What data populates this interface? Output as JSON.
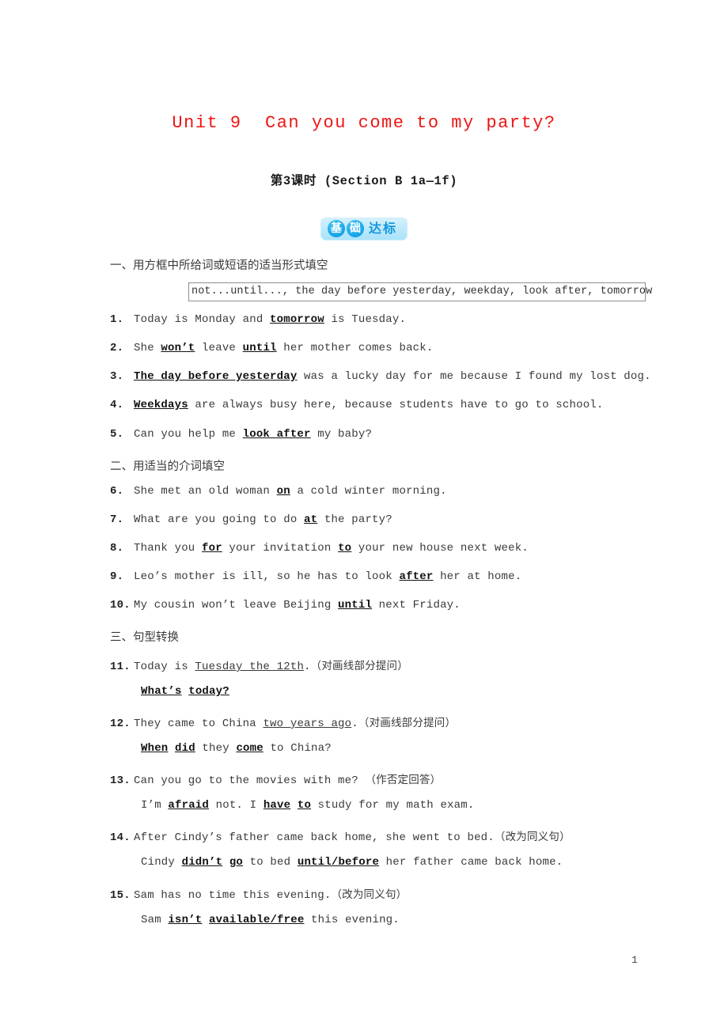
{
  "document": {
    "title": "Unit 9  Can you come to my party?",
    "subtitle": "第3课时 (Section B 1a—1f)",
    "title_color": "#f01414",
    "page_number": "1"
  },
  "badge": {
    "circle_1": "基",
    "circle_2": "础",
    "text": "达标",
    "bg_color": "#bfeafb",
    "circle_color": "#1aa7ea",
    "text_color": "#1597e0"
  },
  "sections": [
    {
      "heading": "一、用方框中所给词或短语的适当形式填空"
    },
    {
      "heading": "二、用适当的介词填空"
    },
    {
      "heading": "三、句型转换"
    }
  ],
  "wordbox": {
    "content": "not...until..., the day before yesterday, weekday, look after, tomorrow"
  },
  "items": [
    {
      "num": "1.",
      "parts": [
        {
          "t": "Today is Monday and ",
          "s": "plain"
        },
        {
          "t": "tomorrow",
          "s": "answer"
        },
        {
          "t": " is Tuesday.",
          "s": "plain"
        }
      ]
    },
    {
      "num": "2.",
      "parts": [
        {
          "t": "She ",
          "s": "plain"
        },
        {
          "t": "won’t",
          "s": "answer"
        },
        {
          "t": " leave ",
          "s": "plain"
        },
        {
          "t": "until",
          "s": "answer"
        },
        {
          "t": " her mother comes back.",
          "s": "plain"
        }
      ]
    },
    {
      "num": "3.",
      "parts": [
        {
          "t": "The day before yesterday",
          "s": "answer"
        },
        {
          "t": " was a lucky day for me because I found my lost dog.",
          "s": "plain"
        }
      ]
    },
    {
      "num": "4.",
      "parts": [
        {
          "t": "Weekdays",
          "s": "answer"
        },
        {
          "t": " are always busy here, because students have to go to school.",
          "s": "plain"
        }
      ]
    },
    {
      "num": "5.",
      "parts": [
        {
          "t": "Can you help me ",
          "s": "plain"
        },
        {
          "t": "look after",
          "s": "answer"
        },
        {
          "t": " my baby?",
          "s": "plain"
        }
      ]
    },
    {
      "num": "6.",
      "parts": [
        {
          "t": "She met an old woman ",
          "s": "plain"
        },
        {
          "t": "on",
          "s": "answer"
        },
        {
          "t": " a cold winter morning.",
          "s": "plain"
        }
      ]
    },
    {
      "num": "7.",
      "parts": [
        {
          "t": "What are you going to do ",
          "s": "plain"
        },
        {
          "t": "at",
          "s": "answer"
        },
        {
          "t": " the party?",
          "s": "plain"
        }
      ]
    },
    {
      "num": "8.",
      "parts": [
        {
          "t": "Thank you ",
          "s": "plain"
        },
        {
          "t": "for",
          "s": "answer"
        },
        {
          "t": " your invitation ",
          "s": "plain"
        },
        {
          "t": "to",
          "s": "answer"
        },
        {
          "t": " your new house next week.",
          "s": "plain"
        }
      ]
    },
    {
      "num": "9.",
      "parts": [
        {
          "t": "Leo’s mother is ill, so he has to look ",
          "s": "plain"
        },
        {
          "t": "after",
          "s": "answer"
        },
        {
          "t": " her at home.",
          "s": "plain"
        }
      ]
    },
    {
      "num": "10.",
      "parts": [
        {
          "t": "My cousin won’t leave Beijing ",
          "s": "plain"
        },
        {
          "t": "until",
          "s": "answer"
        },
        {
          "t": " next Friday.",
          "s": "plain"
        }
      ]
    },
    {
      "num": "11.",
      "parts": [
        {
          "t": "Today is ",
          "s": "plain"
        },
        {
          "t": "Tuesday the 12th",
          "s": "underline"
        },
        {
          "t": ".",
          "s": "plain"
        },
        {
          "t": "（对画线部分提问）",
          "s": "cn"
        }
      ]
    },
    {
      "num": "",
      "answer_line": true,
      "parts": [
        {
          "t": "What’s",
          "s": "answer"
        },
        {
          "t": " ",
          "s": "plain"
        },
        {
          "t": "today?",
          "s": "answer"
        }
      ]
    },
    {
      "num": "12.",
      "parts": [
        {
          "t": "They came to China ",
          "s": "plain"
        },
        {
          "t": "two years ago",
          "s": "underline"
        },
        {
          "t": ".",
          "s": "plain"
        },
        {
          "t": "（对画线部分提问）",
          "s": "cn"
        }
      ]
    },
    {
      "num": "",
      "answer_line": true,
      "parts": [
        {
          "t": "When",
          "s": "answer"
        },
        {
          "t": " ",
          "s": "plain"
        },
        {
          "t": "did",
          "s": "answer"
        },
        {
          "t": " they ",
          "s": "plain"
        },
        {
          "t": "come",
          "s": "answer"
        },
        {
          "t": " to China?",
          "s": "plain"
        }
      ]
    },
    {
      "num": "13.",
      "parts": [
        {
          "t": "Can you go to the movies with me? ",
          "s": "plain"
        },
        {
          "t": "（作否定回答）",
          "s": "cn"
        }
      ]
    },
    {
      "num": "",
      "answer_line": true,
      "parts": [
        {
          "t": "I’m ",
          "s": "plain"
        },
        {
          "t": "afraid",
          "s": "answer"
        },
        {
          "t": " not. I ",
          "s": "plain"
        },
        {
          "t": "have",
          "s": "answer"
        },
        {
          "t": " ",
          "s": "plain"
        },
        {
          "t": "to",
          "s": "answer"
        },
        {
          "t": " study for my math exam.",
          "s": "plain"
        }
      ]
    },
    {
      "num": "14.",
      "parts": [
        {
          "t": "After Cindy’s father came back home, she went to bed.",
          "s": "plain"
        },
        {
          "t": "（改为同义句）",
          "s": "cn"
        }
      ]
    },
    {
      "num": "",
      "answer_line": true,
      "parts": [
        {
          "t": "Cindy ",
          "s": "plain"
        },
        {
          "t": "didn’t",
          "s": "answer"
        },
        {
          "t": " ",
          "s": "plain"
        },
        {
          "t": "go",
          "s": "answer"
        },
        {
          "t": " to bed ",
          "s": "plain"
        },
        {
          "t": "until/before",
          "s": "answer"
        },
        {
          "t": " her father came back home.",
          "s": "plain"
        }
      ]
    },
    {
      "num": "15.",
      "parts": [
        {
          "t": "Sam has no time this evening.",
          "s": "plain"
        },
        {
          "t": "（改为同义句）",
          "s": "cn"
        }
      ]
    },
    {
      "num": "",
      "answer_line": true,
      "parts": [
        {
          "t": "Sam ",
          "s": "plain"
        },
        {
          "t": "isn’t",
          "s": "answer"
        },
        {
          "t": " ",
          "s": "plain"
        },
        {
          "t": "available/free",
          "s": "answer"
        },
        {
          "t": " this evening.",
          "s": "plain"
        }
      ]
    }
  ],
  "layout": {
    "item_tops": [
      396,
      432,
      468,
      504,
      541,
      613,
      649,
      685,
      721,
      757,
      830,
      866,
      902,
      938,
      974,
      1010,
      1046,
      1082,
      1119,
      1155
    ],
    "section_tops": [
      324,
      578,
      794
    ]
  }
}
